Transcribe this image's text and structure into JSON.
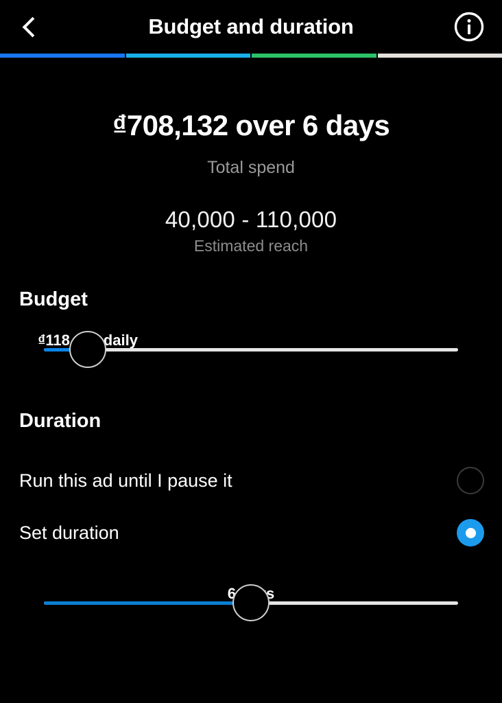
{
  "header": {
    "title": "Budget and duration",
    "back_icon": "chevron-left-icon",
    "info_icon": "info-circle-icon"
  },
  "progress": {
    "segments": [
      {
        "name": "step-1",
        "color": "#1877F2",
        "complete": true
      },
      {
        "name": "step-2",
        "color": "#19AFE8",
        "complete": true
      },
      {
        "name": "step-3",
        "color": "#2CC268",
        "complete": true
      },
      {
        "name": "step-4",
        "color": "#E4E0DC",
        "complete": false
      }
    ]
  },
  "summary": {
    "total_amount": "₫708,132 over 6 days",
    "total_label": "Total spend",
    "reach_range": "40,000 - 110,000",
    "reach_label": "Estimated reach"
  },
  "budget": {
    "section_title": "Budget",
    "value_label": "₫118,022 daily",
    "slider": {
      "fill_color": "#0A84E8",
      "track_color": "#E4E4E4",
      "percent": 10.6
    }
  },
  "duration": {
    "section_title": "Duration",
    "options": [
      {
        "label": "Run this ad until I pause it",
        "selected": false,
        "name": "run-until-paused"
      },
      {
        "label": "Set duration",
        "selected": true,
        "name": "set-duration"
      }
    ],
    "selected_color": "#1C9BED",
    "value_label": "6 days",
    "slider": {
      "fill_color": "#0A7FD4",
      "track_color": "#E4E4E4",
      "percent": 50
    }
  }
}
